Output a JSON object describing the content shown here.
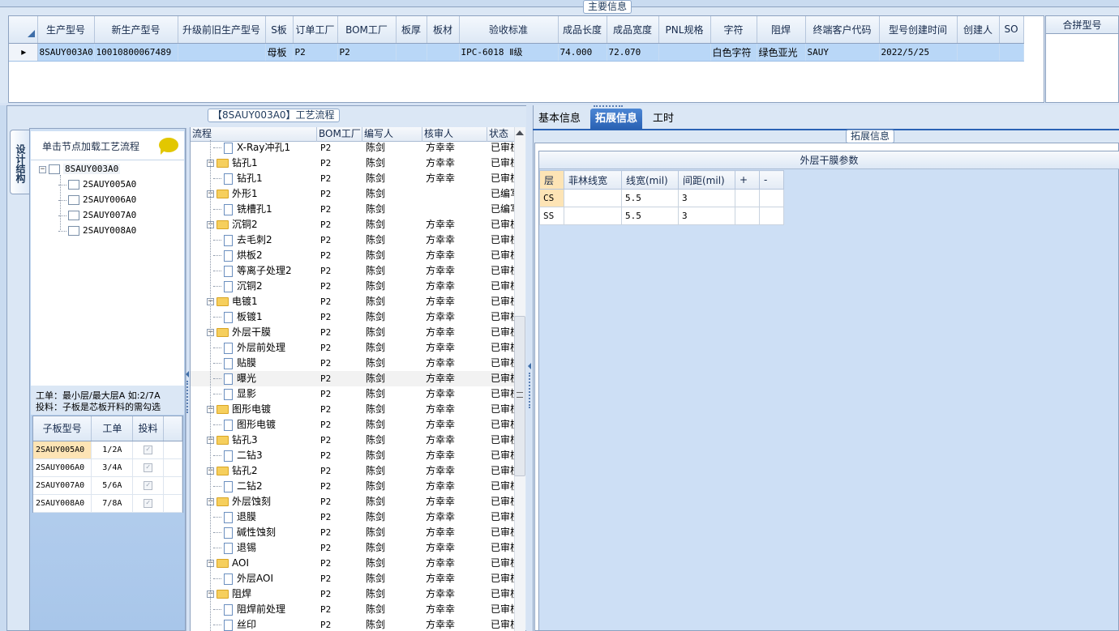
{
  "main_info": {
    "title": "主要信息",
    "columns": [
      "生产型号",
      "新生产型号",
      "升级前旧生产型号",
      "S板",
      "订单工厂",
      "BOM工厂",
      "板厚",
      "板材",
      "验收标准",
      "成品长度",
      "成品宽度",
      "PNL规格",
      "字符",
      "阻焊",
      "终端客户代码",
      "型号创建时间",
      "创建人",
      "SO"
    ],
    "row": [
      "8SAUY003A0",
      "10010800067489",
      "",
      "母板",
      "P2",
      "P2",
      "",
      "",
      "IPC-6018 Ⅱ级",
      "74.000",
      "72.070",
      "",
      "白色字符",
      "绿色亚光",
      "SAUY",
      "2022/5/25",
      "",
      ""
    ],
    "row_indicator": "▸"
  },
  "merge_panel": {
    "title": "合拼型号"
  },
  "process_panel": {
    "title": "【8SAUY003A0】工艺流程",
    "columns": [
      "流程",
      "BOM工厂",
      "编写人",
      "核审人",
      "状态"
    ],
    "rows": [
      {
        "name": "X-Ray冲孔1",
        "bom": "P2",
        "writer": "陈剑",
        "reviewer": "方幸幸",
        "status": "已审核",
        "type": "leaf"
      },
      {
        "name": "钻孔1",
        "bom": "P2",
        "writer": "陈剑",
        "reviewer": "方幸幸",
        "status": "已审核",
        "type": "folder"
      },
      {
        "name": "钻孔1",
        "bom": "P2",
        "writer": "陈剑",
        "reviewer": "方幸幸",
        "status": "已审核",
        "type": "leaf"
      },
      {
        "name": "外形1",
        "bom": "P2",
        "writer": "陈剑",
        "reviewer": "",
        "status": "已编写",
        "type": "folder"
      },
      {
        "name": "铣槽孔1",
        "bom": "P2",
        "writer": "陈剑",
        "reviewer": "",
        "status": "已编写",
        "type": "leaf"
      },
      {
        "name": "沉铜2",
        "bom": "P2",
        "writer": "陈剑",
        "reviewer": "方幸幸",
        "status": "已审核",
        "type": "folder"
      },
      {
        "name": "去毛刺2",
        "bom": "P2",
        "writer": "陈剑",
        "reviewer": "方幸幸",
        "status": "已审核",
        "type": "leaf"
      },
      {
        "name": "烘板2",
        "bom": "P2",
        "writer": "陈剑",
        "reviewer": "方幸幸",
        "status": "已审核",
        "type": "leaf"
      },
      {
        "name": "等离子处理2",
        "bom": "P2",
        "writer": "陈剑",
        "reviewer": "方幸幸",
        "status": "已审核",
        "type": "leaf"
      },
      {
        "name": "沉铜2",
        "bom": "P2",
        "writer": "陈剑",
        "reviewer": "方幸幸",
        "status": "已审核",
        "type": "leaf"
      },
      {
        "name": "电镀1",
        "bom": "P2",
        "writer": "陈剑",
        "reviewer": "方幸幸",
        "status": "已审核",
        "type": "folder"
      },
      {
        "name": "板镀1",
        "bom": "P2",
        "writer": "陈剑",
        "reviewer": "方幸幸",
        "status": "已审核",
        "type": "leaf"
      },
      {
        "name": "外层干膜",
        "bom": "P2",
        "writer": "陈剑",
        "reviewer": "方幸幸",
        "status": "已审核",
        "type": "folder"
      },
      {
        "name": "外层前处理",
        "bom": "P2",
        "writer": "陈剑",
        "reviewer": "方幸幸",
        "status": "已审核",
        "type": "leaf"
      },
      {
        "name": "贴膜",
        "bom": "P2",
        "writer": "陈剑",
        "reviewer": "方幸幸",
        "status": "已审核",
        "type": "leaf"
      },
      {
        "name": "曝光",
        "bom": "P2",
        "writer": "陈剑",
        "reviewer": "方幸幸",
        "status": "已审核",
        "type": "leaf",
        "selected": true
      },
      {
        "name": "显影",
        "bom": "P2",
        "writer": "陈剑",
        "reviewer": "方幸幸",
        "status": "已审核",
        "type": "leaf"
      },
      {
        "name": "图形电镀",
        "bom": "P2",
        "writer": "陈剑",
        "reviewer": "方幸幸",
        "status": "已审核",
        "type": "folder"
      },
      {
        "name": "图形电镀",
        "bom": "P2",
        "writer": "陈剑",
        "reviewer": "方幸幸",
        "status": "已审核",
        "type": "leaf"
      },
      {
        "name": "钻孔3",
        "bom": "P2",
        "writer": "陈剑",
        "reviewer": "方幸幸",
        "status": "已审核",
        "type": "folder"
      },
      {
        "name": "二钻3",
        "bom": "P2",
        "writer": "陈剑",
        "reviewer": "方幸幸",
        "status": "已审核",
        "type": "leaf"
      },
      {
        "name": "钻孔2",
        "bom": "P2",
        "writer": "陈剑",
        "reviewer": "方幸幸",
        "status": "已审核",
        "type": "folder"
      },
      {
        "name": "二钻2",
        "bom": "P2",
        "writer": "陈剑",
        "reviewer": "方幸幸",
        "status": "已审核",
        "type": "leaf"
      },
      {
        "name": "外层蚀刻",
        "bom": "P2",
        "writer": "陈剑",
        "reviewer": "方幸幸",
        "status": "已审核",
        "type": "folder"
      },
      {
        "name": "退膜",
        "bom": "P2",
        "writer": "陈剑",
        "reviewer": "方幸幸",
        "status": "已审核",
        "type": "leaf"
      },
      {
        "name": "碱性蚀刻",
        "bom": "P2",
        "writer": "陈剑",
        "reviewer": "方幸幸",
        "status": "已审核",
        "type": "leaf"
      },
      {
        "name": "退锡",
        "bom": "P2",
        "writer": "陈剑",
        "reviewer": "方幸幸",
        "status": "已审核",
        "type": "leaf"
      },
      {
        "name": "AOI",
        "bom": "P2",
        "writer": "陈剑",
        "reviewer": "方幸幸",
        "status": "已审核",
        "type": "folder"
      },
      {
        "name": "外层AOI",
        "bom": "P2",
        "writer": "陈剑",
        "reviewer": "方幸幸",
        "status": "已审核",
        "type": "leaf"
      },
      {
        "name": "阻焊",
        "bom": "P2",
        "writer": "陈剑",
        "reviewer": "方幸幸",
        "status": "已审核",
        "type": "folder"
      },
      {
        "name": "阻焊前处理",
        "bom": "P2",
        "writer": "陈剑",
        "reviewer": "方幸幸",
        "status": "已审核",
        "type": "leaf"
      },
      {
        "name": "丝印",
        "bom": "P2",
        "writer": "陈剑",
        "reviewer": "方幸幸",
        "status": "已审核",
        "type": "leaf"
      }
    ]
  },
  "side_panel": {
    "vertical_tab": "设计结构",
    "node_hint": "单击节点加载工艺流程",
    "tree": {
      "root": "8SAUY003A0",
      "children": [
        "2SAUY005A0",
        "2SAUY006A0",
        "2SAUY007A0",
        "2SAUY008A0"
      ]
    },
    "note_line1": "工单：最小层/最大层A 如:2/7A",
    "note_line2": "投料：子板是芯板开料的需勾选",
    "sub_columns": [
      "子板型号",
      "工单",
      "投料"
    ],
    "sub_rows": [
      {
        "model": "2SAUY005A0",
        "order": "1/2A",
        "feed": true
      },
      {
        "model": "2SAUY006A0",
        "order": "3/4A",
        "feed": true
      },
      {
        "model": "2SAUY007A0",
        "order": "5/6A",
        "feed": true
      },
      {
        "model": "2SAUY008A0",
        "order": "7/8A",
        "feed": true
      }
    ]
  },
  "right_panel": {
    "tabs": [
      "基本信息",
      "拓展信息",
      "工时"
    ],
    "active_tab": "拓展信息",
    "group_title": "拓展信息",
    "grid_caption": "外层干膜参数",
    "columns": [
      "层",
      "菲林线宽",
      "线宽(mil)",
      "间距(mil)",
      "+",
      "-"
    ],
    "rows": [
      [
        "CS",
        "",
        "5.5",
        "3",
        "",
        ""
      ],
      [
        "SS",
        "",
        "5.5",
        "3",
        "",
        ""
      ]
    ]
  },
  "colors": {
    "selected_row": "#b9d7f7",
    "active_tab": "#2a62b4",
    "highlight": "#fde4b5",
    "panel_bg": "#dbe7f5"
  }
}
